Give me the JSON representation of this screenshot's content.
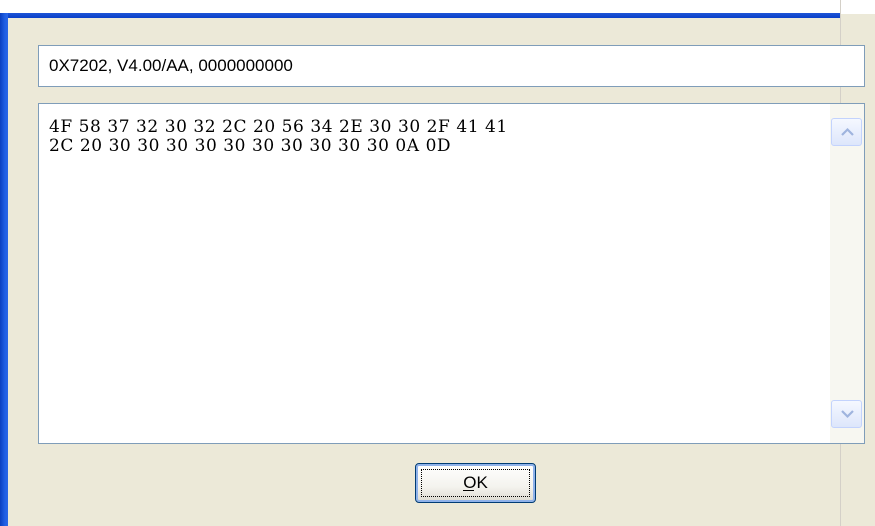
{
  "window": {
    "accent_color": "#0a40c8",
    "client_color": "#ece9d8"
  },
  "response_field": {
    "value": "0X7202, V4.00/AA, 0000000000"
  },
  "hex_dump": {
    "lines": [
      "4F 58 37 32 30 32 2C 20 56 34 2E 30 30 2F 41 41",
      "2C 20 30 30 30 30 30 30 30 30 30 30 0A 0D"
    ]
  },
  "scrollbar": {
    "up_icon": "arrow-up-icon",
    "down_icon": "arrow-down-icon"
  },
  "ok_button": {
    "label": "OK"
  }
}
